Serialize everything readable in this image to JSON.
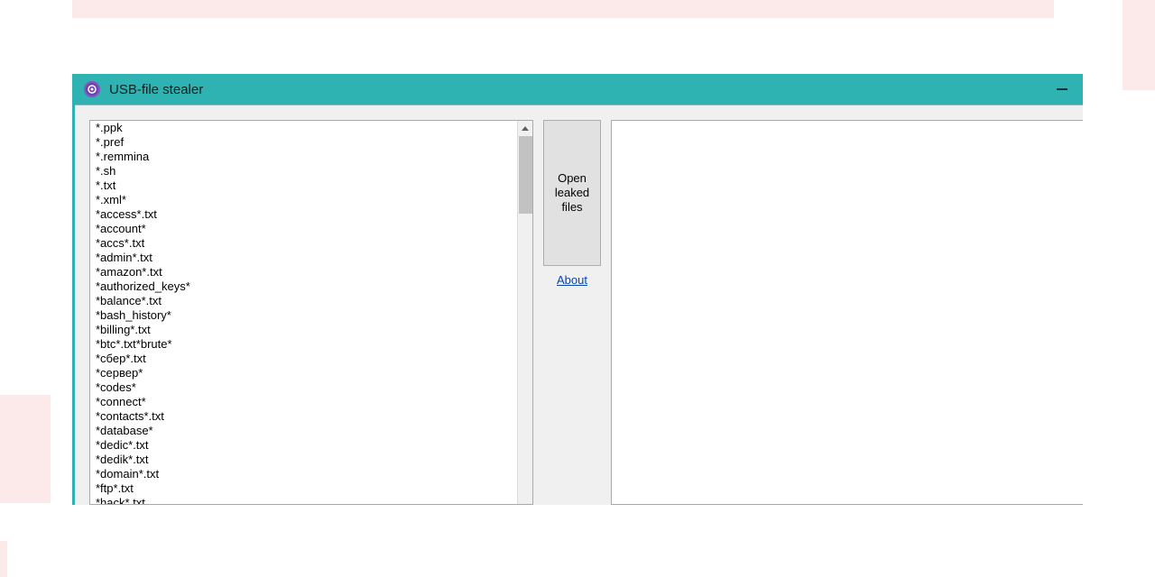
{
  "window": {
    "title": "USB-file stealer"
  },
  "sidebar": {
    "open_button_label": "Open leaked files",
    "about_label": "About"
  },
  "patterns": [
    "*.ppk",
    "*.pref",
    "*.remmina",
    "*.sh",
    "*.txt",
    "*.xml*",
    "*access*.txt",
    "*account*",
    "*accs*.txt",
    "*admin*.txt",
    "*amazon*.txt",
    "*authorized_keys*",
    "*balance*.txt",
    "*bash_history*",
    "*billing*.txt",
    "*btc*.txt*brute*",
    "*сбер*.txt",
    "*сервер*",
    "*codes*",
    "*connect*",
    "*contacts*.txt",
    "*database*",
    "*dedic*.txt",
    "*dedik*.txt",
    "*domain*.txt",
    "*ftp*.txt",
    "*hack*.txt"
  ]
}
